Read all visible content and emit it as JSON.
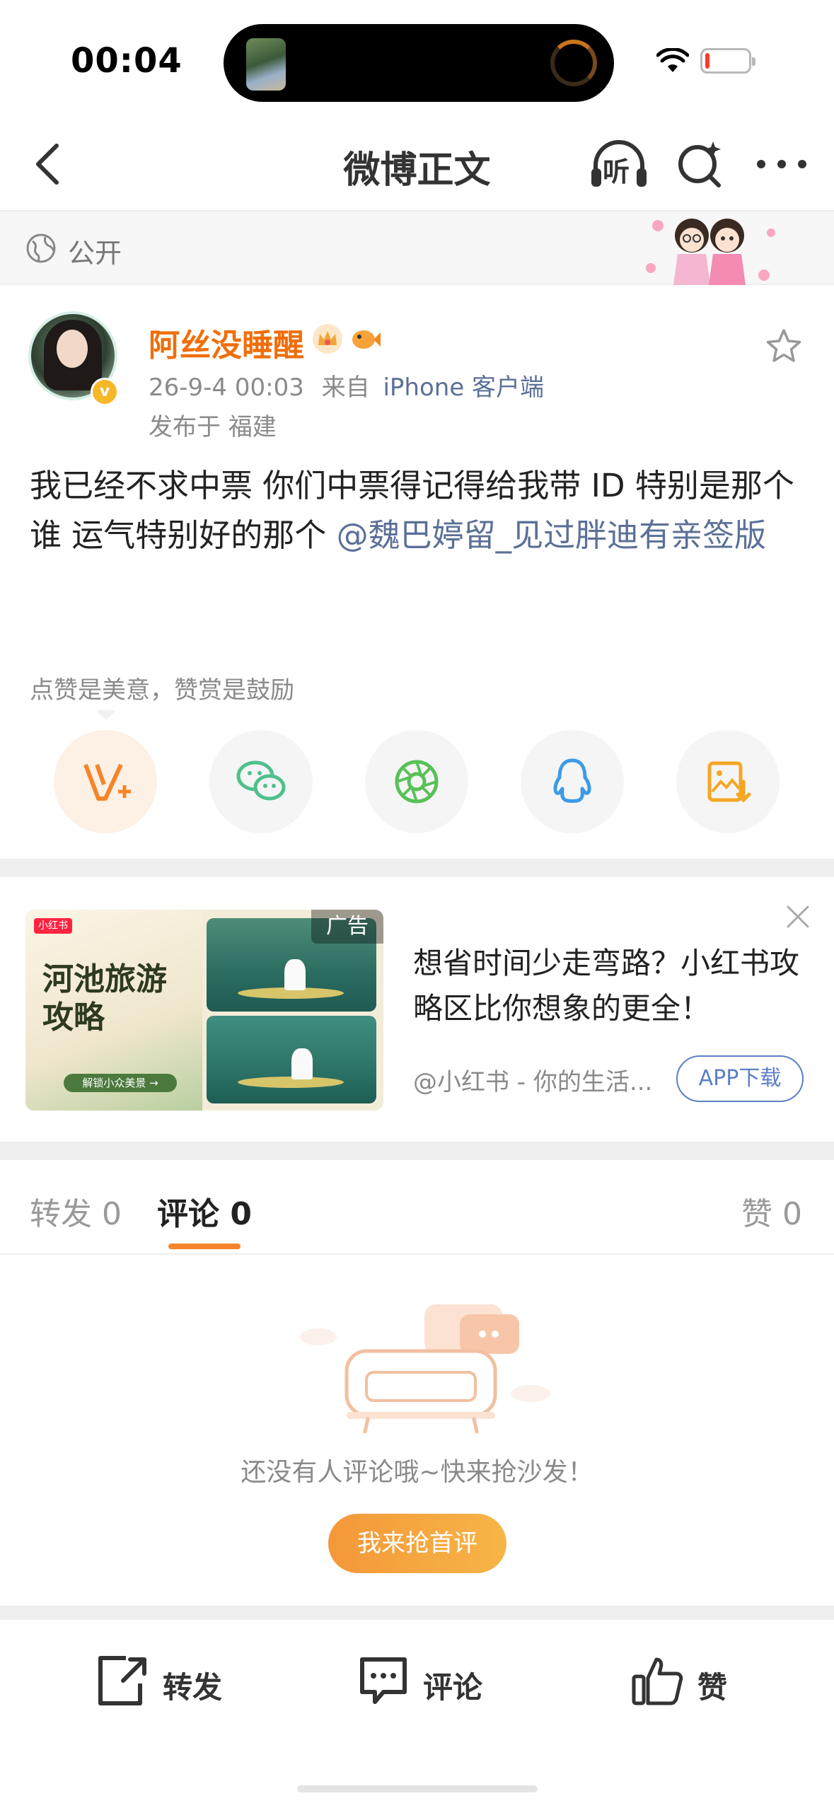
{
  "status_bar": {
    "time": "00:04",
    "battery_level": 0.1,
    "battery_color": "#ff3b30"
  },
  "nav": {
    "title": "微博正文",
    "listen_label": "听",
    "icons": [
      "back-icon",
      "listen-icon",
      "search-icon",
      "more-icon"
    ]
  },
  "visibility": {
    "label": "公开",
    "icon": "globe-icon"
  },
  "post": {
    "username": "阿丝没睡醒",
    "username_color": "#f06e0a",
    "verified_mark": "v",
    "time": "26-9-4 00:03",
    "from_prefix": "来自",
    "source": "iPhone 客户端",
    "location": "发布于 福建",
    "text_before_mention": "我已经不求中票  你们中票得记得给我带 ID  特别是那个谁 运气特别好的那个 ",
    "mention": "@魏巴婷留_见过胖迪有亲签版",
    "mention_color": "#5b7097",
    "tip": "点赞是美意，赞赏是鼓励",
    "share_targets": [
      "reward-icon",
      "wechat-icon",
      "moments-icon",
      "qq-icon",
      "save-image-icon"
    ]
  },
  "ad": {
    "tag": "广告",
    "image_brand": "小红书",
    "image_title_line1": "河池旅游",
    "image_title_line2": "攻略",
    "image_cta": "解锁小众美景 →",
    "title": "想省时间少走弯路？小红书攻略区比你想象的更全！",
    "source": "@小红书 - 你的生活...",
    "download_label": "APP下载",
    "accent_color": "#5b7fc7"
  },
  "tabs": [
    {
      "label": "转发 0",
      "active": false
    },
    {
      "label": "评论 0",
      "active": true
    },
    {
      "label": "赞 0",
      "active": false
    }
  ],
  "tab_accent": "#f5852a",
  "empty_state": {
    "message": "还没有人评论哦~快来抢沙发！",
    "button_label": "我来抢首评",
    "illustration": "sofa-icon"
  },
  "bottom_bar": {
    "repost_label": "转发",
    "comment_label": "评论",
    "like_label": "赞"
  }
}
